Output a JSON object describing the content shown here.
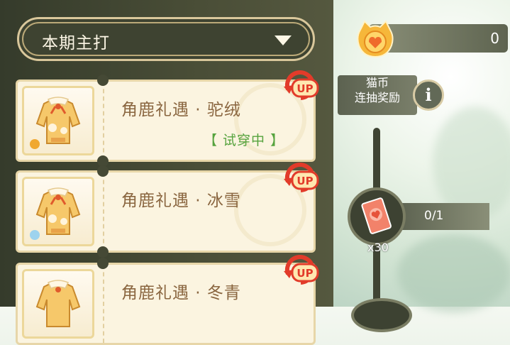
{
  "filter": {
    "selected": "本期主打"
  },
  "items": [
    {
      "name": "角鹿礼遇 · 驼绒",
      "status": "【 试穿中 】",
      "badge": "UP",
      "gem_color": "#f0a830"
    },
    {
      "name": "角鹿礼遇 · 冰雪",
      "status": "",
      "badge": "UP",
      "gem_color": "#9ed3ee"
    },
    {
      "name": "角鹿礼遇 · 冬青",
      "status": "",
      "badge": "UP",
      "gem_color": "#f0a830"
    }
  ],
  "currency": {
    "value": "0",
    "icon": "cat-coin-icon"
  },
  "reward_info": {
    "line1": "猫币",
    "line2": "连抽奖励",
    "icon": "info-icon"
  },
  "milestone": {
    "progress": "0/1",
    "reward_count": "x30",
    "icon": "cat-coin-ticket-icon"
  },
  "colors": {
    "accent_gold": "#d9c79b",
    "status_green": "#56a33e",
    "name_brown": "#8a6640"
  }
}
